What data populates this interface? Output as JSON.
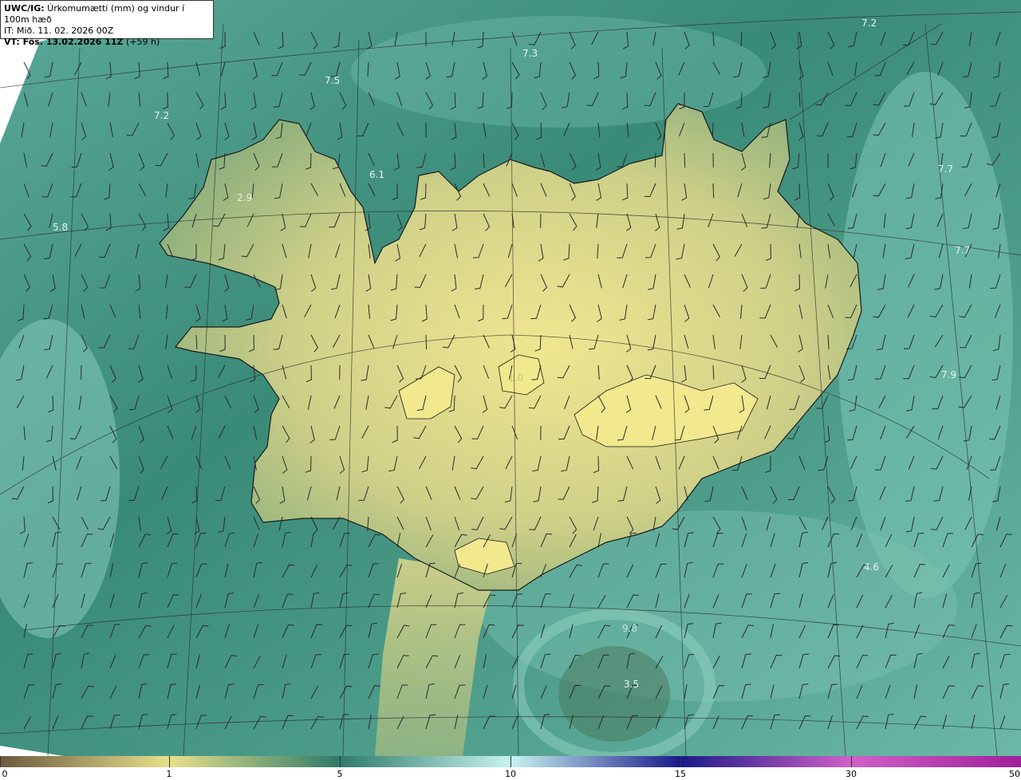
{
  "info": {
    "model_prefix": "UWC/IG:",
    "title_rest": " Úrkomumætti (mm) og vindur í 100m hæð",
    "init_time": "IT: Mið. 11. 02. 2026 00Z",
    "valid_prefix": "VT: Fös. 13.02.2026 11Z",
    "valid_suffix": " (+59 h)"
  },
  "map_labels": [
    {
      "text": "7.2"
    },
    {
      "text": "7.3"
    },
    {
      "text": "7.5"
    },
    {
      "text": "7.2"
    },
    {
      "text": "6.1"
    },
    {
      "text": "2.9"
    },
    {
      "text": "5.8"
    },
    {
      "text": "7.7"
    },
    {
      "text": "7.7"
    },
    {
      "text": "1.0"
    },
    {
      "text": "7.9"
    },
    {
      "text": "4.6"
    },
    {
      "text": "3.5"
    },
    {
      "text": "9.8"
    }
  ],
  "colorbar": {
    "ticks": [
      "0",
      "1",
      "5",
      "10",
      "15",
      "30",
      "50"
    ],
    "colors": [
      "#6b5a3e",
      "#e8e08a",
      "#2e7a6a",
      "#c8f4f0",
      "#1a1a8a",
      "#d060c8",
      "#a0209a"
    ]
  },
  "colors": {
    "land": "#e0d98a",
    "sea": "#3f8f7e",
    "sea_light": "#7cc4b4",
    "coast": "#1a1a1a"
  }
}
